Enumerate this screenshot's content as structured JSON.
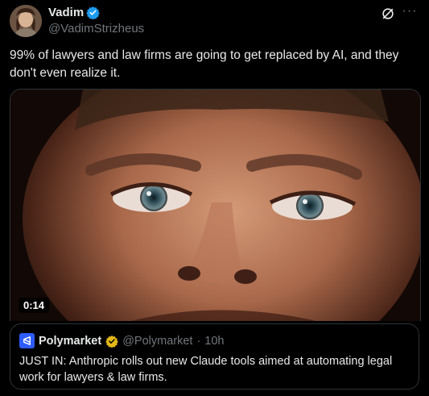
{
  "author": {
    "name": "Vadim",
    "handle": "@VadimStrizheus",
    "verified_color": "#1d9bf0"
  },
  "actions": {
    "grok_icon": "grok-icon",
    "more_label": "···"
  },
  "tweet": {
    "text": "99% of lawyers and law firms are going to get replaced by AI, and they don't even realize it."
  },
  "media": {
    "duration": "0:14"
  },
  "quoted": {
    "name": "Polymarket",
    "handle": "@Polymarket",
    "separator": "·",
    "time": "10h",
    "text": "JUST IN: Anthropic rolls out new Claude tools aimed at automating legal work for lawyers & law firms.",
    "badge_color": "#e2b719",
    "logo_color": "#2e5cff"
  }
}
